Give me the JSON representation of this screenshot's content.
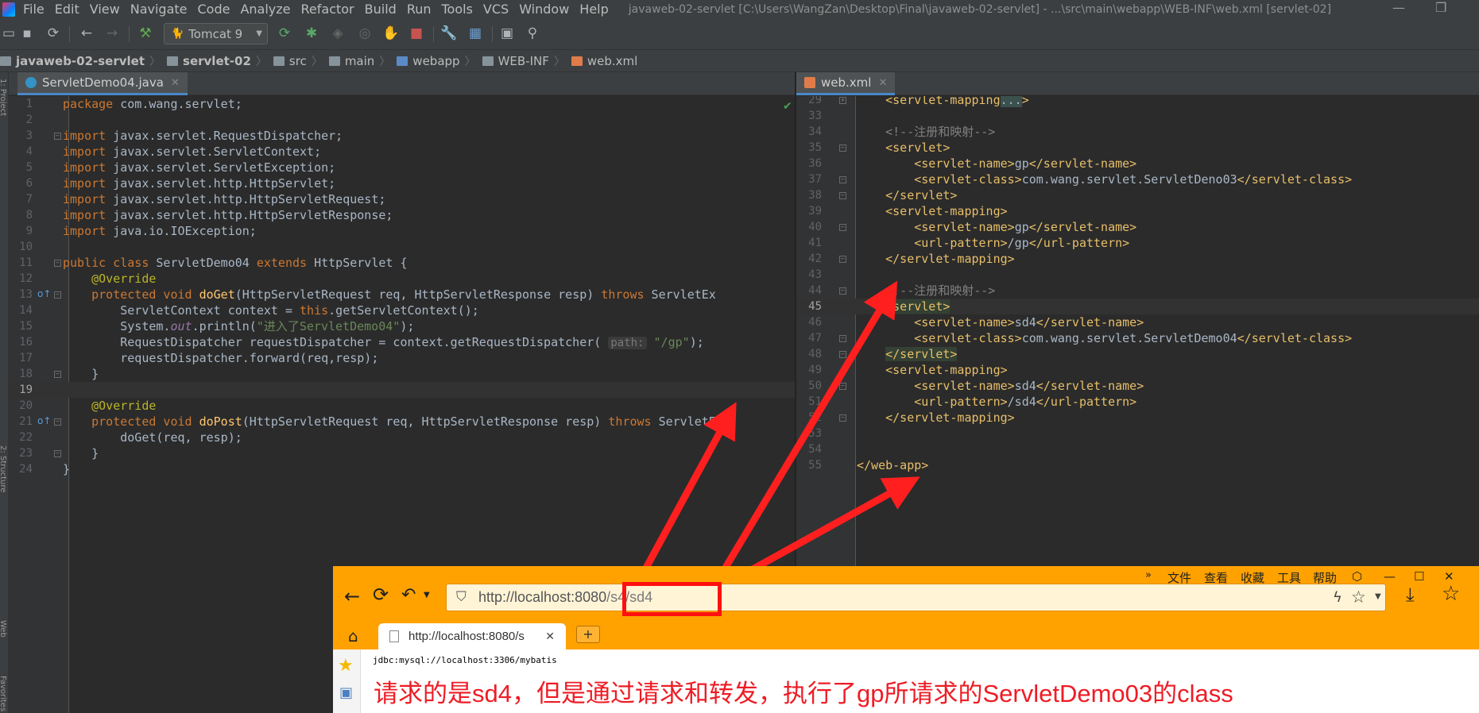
{
  "menubar": {
    "items": [
      "File",
      "Edit",
      "View",
      "Navigate",
      "Code",
      "Analyze",
      "Refactor",
      "Build",
      "Run",
      "Tools",
      "VCS",
      "Window",
      "Help"
    ],
    "title": "javaweb-02-servlet [C:\\Users\\WangZan\\Desktop\\Final\\javaweb-02-servlet] - ...\\src\\main\\webapp\\WEB-INF\\web.xml [servlet-02]"
  },
  "toolbar": {
    "run_config": "Tomcat 9",
    "icons": [
      "open-icon",
      "save-icon",
      "sync-icon",
      "back-icon",
      "forward-icon",
      "build-hammer-icon",
      "run-icon",
      "debug-icon",
      "coverage-icon",
      "profile-icon",
      "attach-icon",
      "stop-icon",
      "settings-wrench-icon",
      "project-structure-icon",
      "terminal-icon",
      "search-icon"
    ]
  },
  "breadcrumb": [
    {
      "label": "javaweb-02-servlet",
      "bold": true
    },
    {
      "label": "servlet-02",
      "bold": true
    },
    {
      "label": "src",
      "bold": false
    },
    {
      "label": "main",
      "bold": false
    },
    {
      "label": "webapp",
      "bold": false
    },
    {
      "label": "WEB-INF",
      "bold": false
    },
    {
      "label": "web.xml",
      "bold": false
    }
  ],
  "left_stripe": {
    "labels": [
      "1: Project",
      "2: Structure",
      "Web",
      "Favorites"
    ]
  },
  "left_editor": {
    "tab": "ServletDemo04.java",
    "lines": [
      {
        "n": "1",
        "html": "<span class='kw'>package</span> com.wang.servlet;"
      },
      {
        "n": "2",
        "html": ""
      },
      {
        "n": "3",
        "html": "<span class='kw'>import</span> javax.servlet.RequestDispatcher;"
      },
      {
        "n": "4",
        "html": "<span class='kw'>import</span> javax.servlet.ServletContext;"
      },
      {
        "n": "5",
        "html": "<span class='kw'>import</span> javax.servlet.ServletException;"
      },
      {
        "n": "6",
        "html": "<span class='kw'>import</span> javax.servlet.http.HttpServlet;"
      },
      {
        "n": "7",
        "html": "<span class='kw'>import</span> javax.servlet.http.HttpServletRequest;"
      },
      {
        "n": "8",
        "html": "<span class='kw'>import</span> javax.servlet.http.HttpServletResponse;"
      },
      {
        "n": "9",
        "html": "<span class='kw'>import</span> java.io.IOException;"
      },
      {
        "n": "10",
        "html": ""
      },
      {
        "n": "11",
        "html": "<span class='kw'>public class</span> ServletDemo04 <span class='kw'>extends</span> HttpServlet {"
      },
      {
        "n": "12",
        "html": "    <span class='ann'>@Override</span>"
      },
      {
        "n": "13",
        "html": "    <span class='kw'>protected void</span> <span class='fn'>doGet</span>(HttpServletRequest req, HttpServletResponse resp) <span class='kw'>throws</span> ServletEx"
      },
      {
        "n": "14",
        "html": "        ServletContext context = <span class='kw'>this</span>.getServletContext();"
      },
      {
        "n": "15",
        "html": "        System.<span class='stat'>out</span>.println(<span class='str'>\"进入了ServletDemo04\"</span>);"
      },
      {
        "n": "16",
        "html": "        RequestDispatcher requestDispatcher = context.getRequestDispatcher( <span class='hint'>path:</span> <span class='str'>\"/gp\"</span>);"
      },
      {
        "n": "17",
        "html": "        requestDispatcher.forward(req,resp);"
      },
      {
        "n": "18",
        "html": "    }"
      },
      {
        "n": "19",
        "html": ""
      },
      {
        "n": "20",
        "html": "    <span class='ann'>@Override</span>"
      },
      {
        "n": "21",
        "html": "    <span class='kw'>protected void</span> <span class='fn'>doPost</span>(HttpServletRequest req, HttpServletResponse resp) <span class='kw'>throws</span> ServletE"
      },
      {
        "n": "22",
        "html": "        doGet(req, resp);"
      },
      {
        "n": "23",
        "html": "    }"
      },
      {
        "n": "24",
        "html": "}"
      }
    ]
  },
  "right_editor": {
    "tab": "web.xml",
    "lines": [
      {
        "n": "29",
        "html": "    <span class='tag'>&lt;servlet-mapping</span><span class='fold-txt'>...</span><span class='tag'>&gt;</span>"
      },
      {
        "n": "33",
        "html": ""
      },
      {
        "n": "34",
        "html": "    <span class='cmt'>&lt;!--注册和映射--&gt;</span>"
      },
      {
        "n": "35",
        "html": "    <span class='tag'>&lt;servlet&gt;</span>"
      },
      {
        "n": "36",
        "html": "        <span class='tag'>&lt;servlet-name&gt;</span>gp<span class='tag'>&lt;/servlet-name&gt;</span>"
      },
      {
        "n": "37",
        "html": "        <span class='tag'>&lt;servlet-class&gt;</span>com.wang.servlet.ServletDeno03<span class='tag'>&lt;/servlet-class&gt;</span>"
      },
      {
        "n": "38",
        "html": "    <span class='tag'>&lt;/servlet&gt;</span>"
      },
      {
        "n": "39",
        "html": "    <span class='tag'>&lt;servlet-mapping&gt;</span>"
      },
      {
        "n": "40",
        "html": "        <span class='tag'>&lt;servlet-name&gt;</span>gp<span class='tag'>&lt;/servlet-name&gt;</span>"
      },
      {
        "n": "41",
        "html": "        <span class='tag'>&lt;url-pattern&gt;</span>/gp<span class='tag'>&lt;/url-pattern&gt;</span>"
      },
      {
        "n": "42",
        "html": "    <span class='tag'>&lt;/servlet-mapping&gt;</span>"
      },
      {
        "n": "43",
        "html": ""
      },
      {
        "n": "44",
        "html": "    <span class='cmt'>&lt;!--注册和映射--&gt;</span>"
      },
      {
        "n": "45",
        "html": "    <span class='tag tag-hl'>&lt;servlet&gt;</span>"
      },
      {
        "n": "46",
        "html": "        <span class='tag'>&lt;servlet-name&gt;</span>sd4<span class='tag'>&lt;/servlet-name&gt;</span>"
      },
      {
        "n": "47",
        "html": "        <span class='tag'>&lt;servlet-class&gt;</span>com.wang.servlet.ServletDemo04<span class='tag'>&lt;/servlet-class&gt;</span>"
      },
      {
        "n": "48",
        "html": "    <span class='tag tag-hl'>&lt;/servlet&gt;</span>"
      },
      {
        "n": "49",
        "html": "    <span class='tag'>&lt;servlet-mapping&gt;</span>"
      },
      {
        "n": "50",
        "html": "        <span class='tag'>&lt;servlet-name&gt;</span>sd4<span class='tag'>&lt;/servlet-name&gt;</span>"
      },
      {
        "n": "51",
        "html": "        <span class='tag'>&lt;url-pattern&gt;</span>/sd4<span class='tag'>&lt;/url-pattern&gt;</span>"
      },
      {
        "n": "52",
        "html": "    <span class='tag'>&lt;/servlet-mapping&gt;</span>"
      },
      {
        "n": "53",
        "html": ""
      },
      {
        "n": "54",
        "html": ""
      },
      {
        "n": "55",
        "html": "<span class='tag'>&lt;/web-app&gt;</span>"
      }
    ]
  },
  "browser": {
    "menu": [
      "文件",
      "查看",
      "收藏",
      "工具",
      "帮助"
    ],
    "url_host": "http://localhost:8080",
    "url_path": "/s4/sd4",
    "tab_title": "http://localhost:8080/s",
    "new_tab": "+",
    "page_text": "jdbc:mysql://localhost:3306/mybatis",
    "annotation": "请求的是sd4，但是通过请求和转发，执行了gp所请求的ServletDemo03的class"
  },
  "colors": {
    "annotation": "#ee1c25",
    "browser_chrome": "#ffa200",
    "ide_bg": "#2b2b2b"
  }
}
